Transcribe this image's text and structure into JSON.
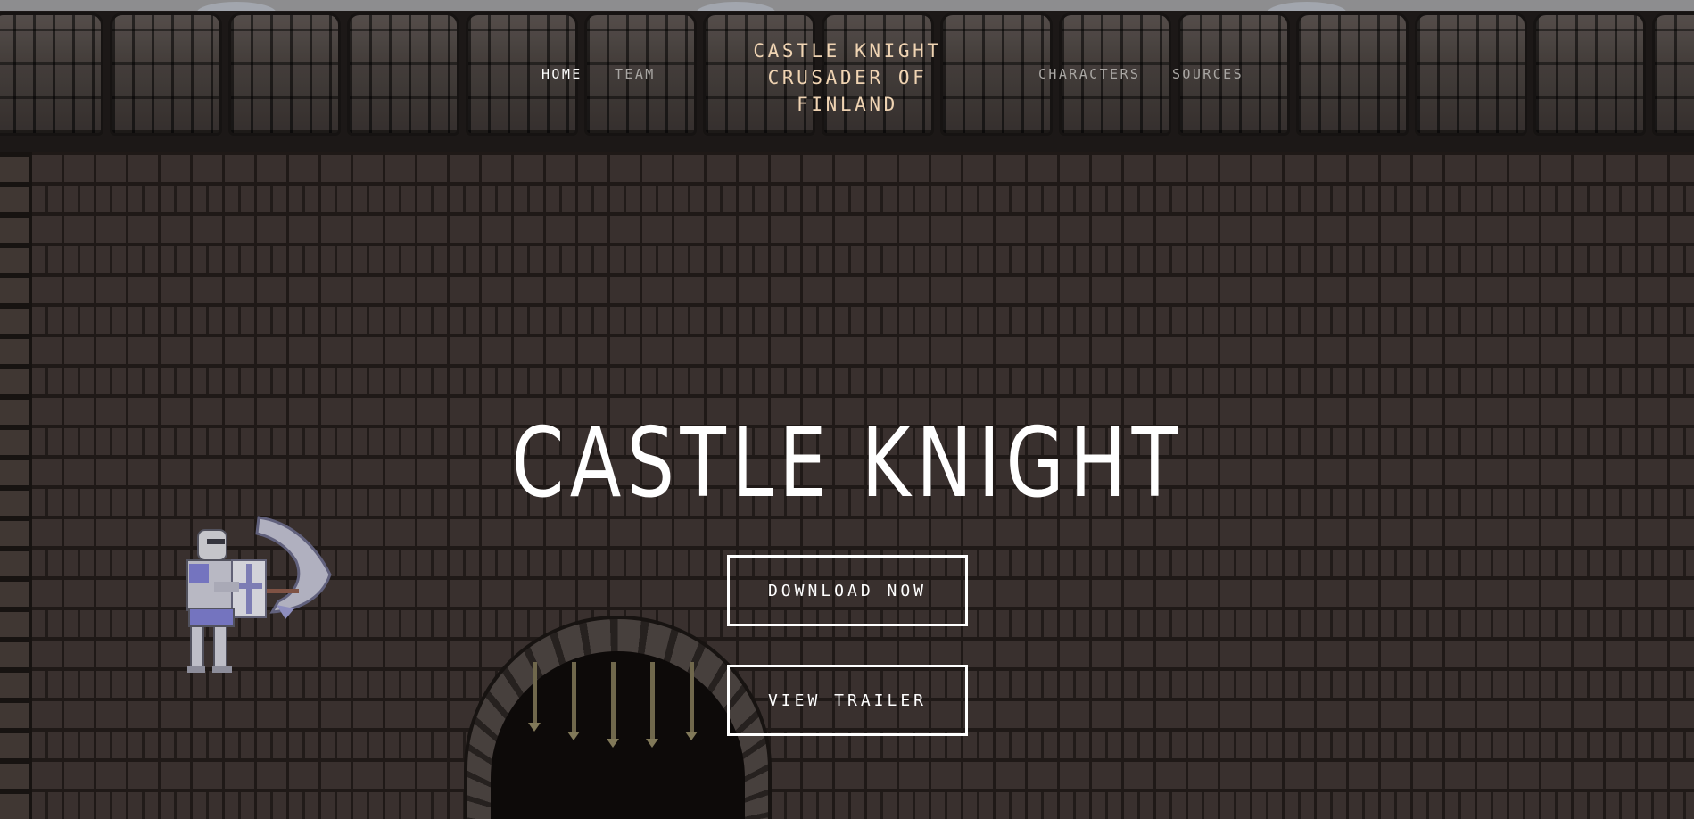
{
  "nav": {
    "items": [
      {
        "label": "HOME",
        "active": true
      },
      {
        "label": "TEAM",
        "active": false
      },
      {
        "label": "CHARACTERS",
        "active": false
      },
      {
        "label": "SOURCES",
        "active": false
      }
    ]
  },
  "site_title": {
    "lines": [
      "CASTLE KNIGHT",
      "CRUSADER OF",
      "FINLAND"
    ]
  },
  "hero": {
    "heading": "CASTLE KNIGHT",
    "download_label": "DOWNLOAD NOW",
    "trailer_label": "VIEW TRAILER"
  },
  "colors": {
    "title_text": "#f0d4b3",
    "nav_active": "#ffffff",
    "nav_inactive": "#a9a6a3",
    "brick": "#3e3532",
    "mortar": "#221c1a"
  },
  "scene": {
    "sprites": [
      "knight-sprite",
      "portcullis-arch"
    ]
  }
}
